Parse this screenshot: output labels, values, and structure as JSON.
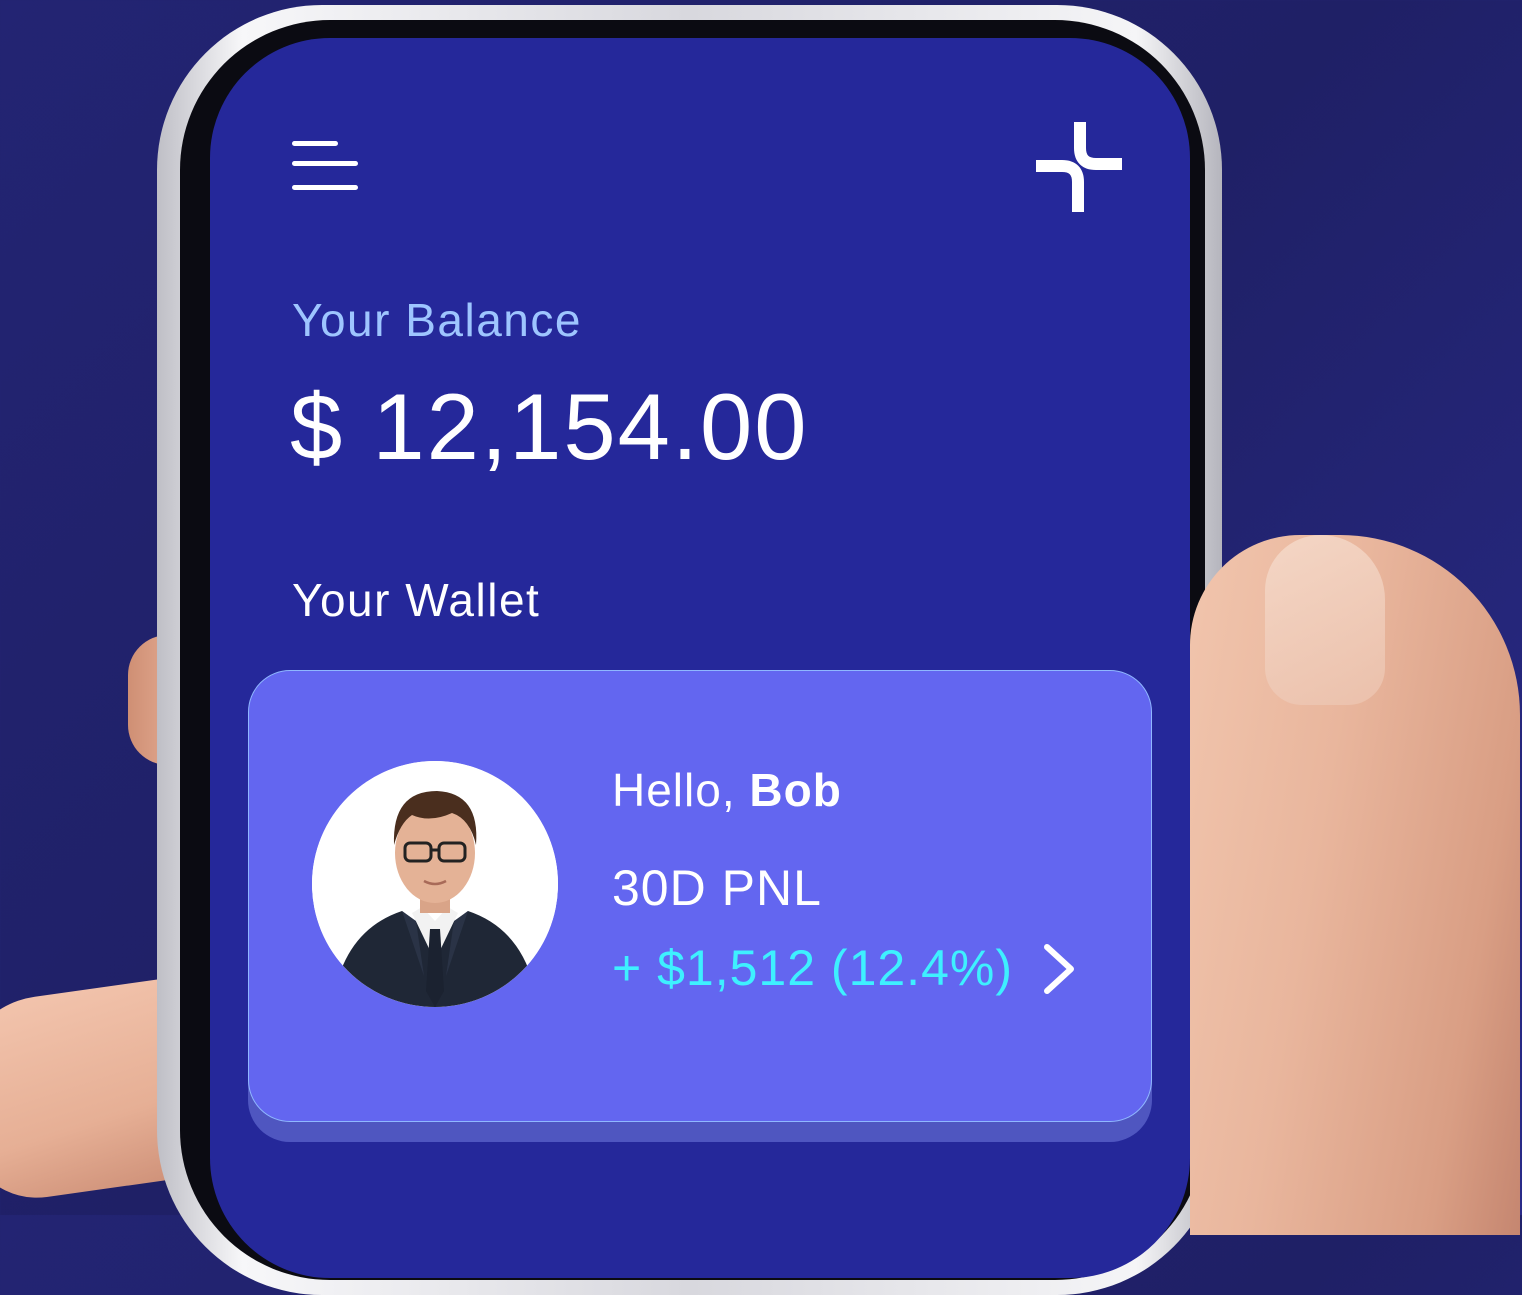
{
  "header": {
    "menu_icon": "hamburger-menu-icon",
    "logo_icon": "brand-logo-icon"
  },
  "balance": {
    "label": "Your Balance",
    "amount": "$ 12,154.00"
  },
  "wallet": {
    "section_label": "Your Wallet",
    "card": {
      "greeting_prefix": "Hello, ",
      "user_name": "Bob",
      "pnl_label": "30D PNL",
      "pnl_value": "+ $1,512 (12.4%)",
      "chevron_icon": "chevron-right-icon"
    }
  },
  "colors": {
    "background": "#232473",
    "screen": "#25289a",
    "card": "#6366f0",
    "balance_label": "#9ec5ff",
    "pnl_positive": "#3ef0ff",
    "text": "#ffffff"
  }
}
